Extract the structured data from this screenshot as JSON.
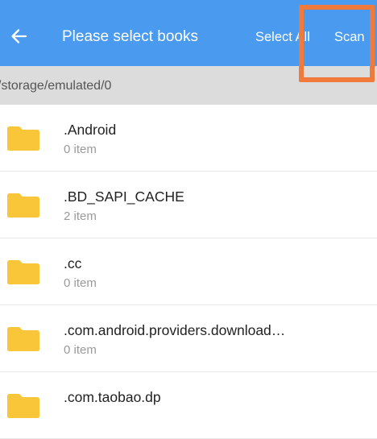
{
  "header": {
    "title": "Please select books",
    "select_all_label": "Select All",
    "scan_label": "Scan",
    "back_icon": "arrow-left-icon",
    "background_color": "#4a9af0",
    "highlight_color": "#f07a3c"
  },
  "path": {
    "text": "/storage/emulated/0"
  },
  "files": [
    {
      "name": ".Android",
      "count": "0 item",
      "icon": "folder-icon"
    },
    {
      "name": ".BD_SAPI_CACHE",
      "count": "2 item",
      "icon": "folder-icon"
    },
    {
      "name": ".cc",
      "count": "0 item",
      "icon": "folder-icon"
    },
    {
      "name": ".com.android.providers.download…",
      "count": "0 item",
      "icon": "folder-icon"
    },
    {
      "name": ".com.taobao.dp",
      "count": "",
      "icon": "folder-icon"
    }
  ],
  "folder_color": "#f9c63a"
}
